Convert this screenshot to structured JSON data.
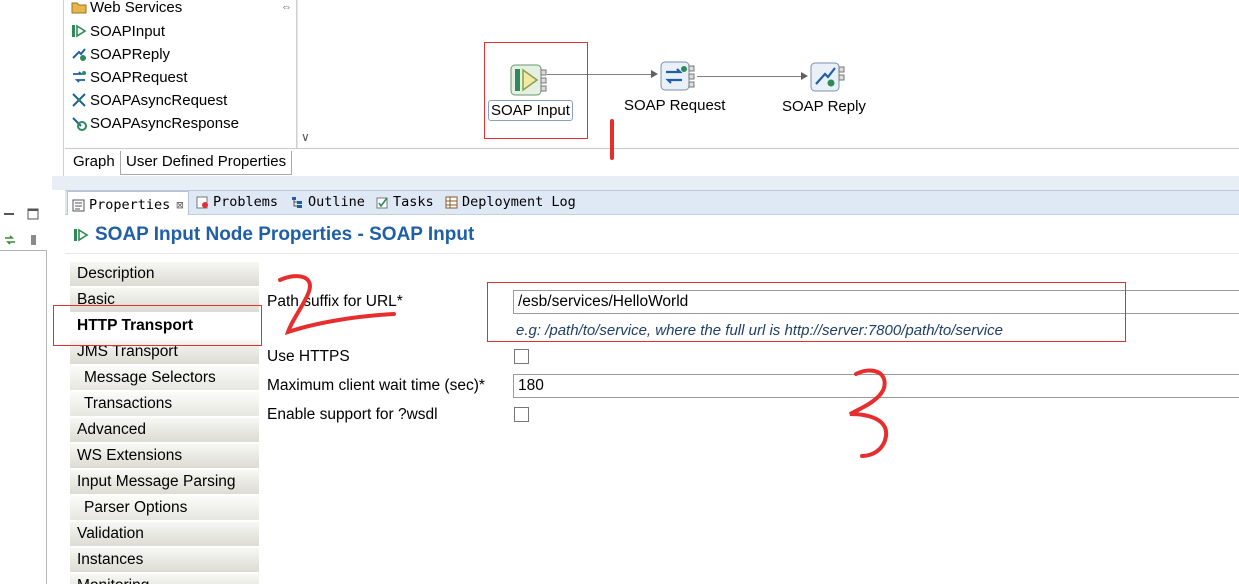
{
  "palette": {
    "category": "Web Services",
    "items": [
      {
        "label": "SOAPInput",
        "icon": "soap-input-icon"
      },
      {
        "label": "SOAPReply",
        "icon": "soap-reply-icon"
      },
      {
        "label": "SOAPRequest",
        "icon": "soap-request-icon"
      },
      {
        "label": "SOAPAsyncRequest",
        "icon": "soap-async-request-icon"
      },
      {
        "label": "SOAPAsyncResponse",
        "icon": "soap-async-response-icon"
      }
    ]
  },
  "canvas": {
    "nodes": [
      {
        "label": "SOAP Input",
        "icon": "soap-input-node-icon"
      },
      {
        "label": "SOAP Request",
        "icon": "soap-request-node-icon"
      },
      {
        "label": "SOAP Reply",
        "icon": "soap-reply-node-icon"
      }
    ]
  },
  "editor_tabs": [
    {
      "label": "Graph",
      "active": false
    },
    {
      "label": "User Defined Properties",
      "active": true
    }
  ],
  "views": {
    "tabs": [
      {
        "label": "Properties",
        "icon": "properties-icon",
        "active": true
      },
      {
        "label": "Problems",
        "icon": "problems-icon",
        "active": false
      },
      {
        "label": "Outline",
        "icon": "outline-icon",
        "active": false
      },
      {
        "label": "Tasks",
        "icon": "tasks-icon",
        "active": false
      },
      {
        "label": "Deployment Log",
        "icon": "deployment-log-icon",
        "active": false
      }
    ],
    "close_glyph": "⊠"
  },
  "properties": {
    "title": "SOAP Input Node Properties - SOAP Input",
    "sections": [
      {
        "label": "Description",
        "sub": false
      },
      {
        "label": "Basic",
        "sub": false
      },
      {
        "label": "HTTP Transport",
        "sub": false,
        "selected": true
      },
      {
        "label": "JMS Transport",
        "sub": false
      },
      {
        "label": "Message Selectors",
        "sub": true
      },
      {
        "label": "Transactions",
        "sub": true
      },
      {
        "label": "Advanced",
        "sub": false
      },
      {
        "label": "WS Extensions",
        "sub": false
      },
      {
        "label": "Input Message Parsing",
        "sub": false
      },
      {
        "label": "Parser Options",
        "sub": true
      },
      {
        "label": "Validation",
        "sub": false
      },
      {
        "label": "Instances",
        "sub": false
      },
      {
        "label": "Monitoring",
        "sub": false
      }
    ],
    "fields": {
      "path_suffix_label": "Path suffix for URL*",
      "path_suffix_value": "/esb/services/HelloWorld",
      "path_suffix_hint": "e.g: /path/to/service, where the full url is http://server:7800/path/to/service",
      "use_https_label": "Use HTTPS",
      "use_https_checked": false,
      "max_wait_label": "Maximum client wait time (sec)*",
      "max_wait_value": "180",
      "wsdl_label": "Enable support for ?wsdl",
      "wsdl_checked": false
    }
  },
  "colors": {
    "title_blue": "#1f5fa6",
    "annotation_red": "#e03030",
    "view_tabbar": "#dfe8f5"
  }
}
